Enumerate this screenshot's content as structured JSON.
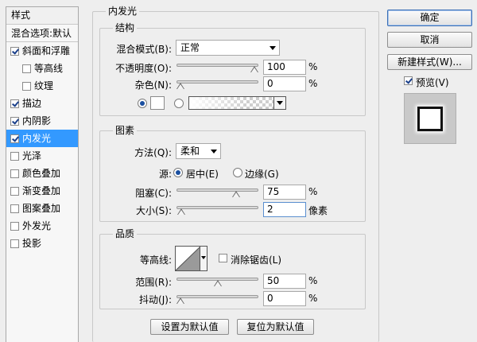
{
  "sidebar": {
    "header": "样式",
    "blend_item": "混合选项:默认",
    "items": [
      {
        "label": "斜面和浮雕",
        "checked": true,
        "sub": false,
        "selected": false
      },
      {
        "label": "等高线",
        "checked": false,
        "sub": true,
        "selected": false
      },
      {
        "label": "纹理",
        "checked": false,
        "sub": true,
        "selected": false
      },
      {
        "label": "描边",
        "checked": true,
        "sub": false,
        "selected": false
      },
      {
        "label": "内阴影",
        "checked": true,
        "sub": false,
        "selected": false
      },
      {
        "label": "内发光",
        "checked": true,
        "sub": false,
        "selected": true
      },
      {
        "label": "光泽",
        "checked": false,
        "sub": false,
        "selected": false
      },
      {
        "label": "颜色叠加",
        "checked": false,
        "sub": false,
        "selected": false
      },
      {
        "label": "渐变叠加",
        "checked": false,
        "sub": false,
        "selected": false
      },
      {
        "label": "图案叠加",
        "checked": false,
        "sub": false,
        "selected": false
      },
      {
        "label": "外发光",
        "checked": false,
        "sub": false,
        "selected": false
      },
      {
        "label": "投影",
        "checked": false,
        "sub": false,
        "selected": false
      }
    ]
  },
  "panel": {
    "title": "内发光",
    "structure": {
      "legend": "结构",
      "blend_mode_label": "混合模式(B):",
      "blend_mode_value": "正常",
      "opacity_label": "不透明度(O):",
      "opacity_value": "100",
      "opacity_unit": "%",
      "opacity_level": 100,
      "noise_label": "杂色(N):",
      "noise_value": "0",
      "noise_unit": "%",
      "noise_level": 0,
      "color_swatch": "#ffffff"
    },
    "elements": {
      "legend": "图素",
      "technique_label": "方法(Q):",
      "technique_value": "柔和",
      "source_label": "源:",
      "source_center": "居中(E)",
      "source_edge": "边缘(G)",
      "choke_label": "阻塞(C):",
      "choke_value": "75",
      "choke_unit": "%",
      "choke_level": 75,
      "size_label": "大小(S):",
      "size_value": "2",
      "size_unit": "像素",
      "size_level": 2
    },
    "quality": {
      "legend": "品质",
      "contour_label": "等高线:",
      "anti_alias_label": "消除锯齿(L)",
      "range_label": "范围(R):",
      "range_value": "50",
      "range_unit": "%",
      "range_level": 50,
      "jitter_label": "抖动(J):",
      "jitter_value": "0",
      "jitter_unit": "%",
      "jitter_level": 0
    },
    "make_default": "设置为默认值",
    "reset_default": "复位为默认值"
  },
  "buttons": {
    "ok": "确定",
    "cancel": "取消",
    "new_style": "新建样式(W)...",
    "preview_label": "预览(V)"
  }
}
